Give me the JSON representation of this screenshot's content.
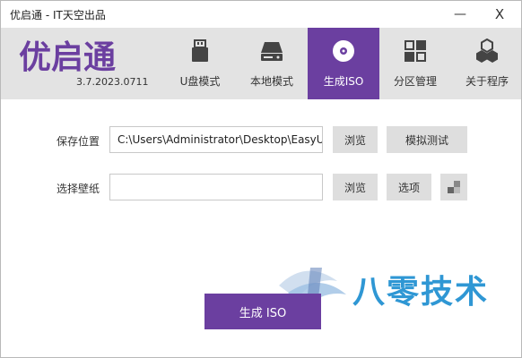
{
  "window": {
    "title": "优启通 - IT天空出品",
    "minimize_glyph": "—",
    "close_glyph": "X"
  },
  "header": {
    "version": "3.7.2023.0711",
    "logo_text": "优启通",
    "accent": "#6b3fa0",
    "nav": [
      {
        "label": "U盘模式",
        "icon": "usb-drive-icon"
      },
      {
        "label": "本地模式",
        "icon": "hard-drive-icon"
      },
      {
        "label": "生成ISO",
        "icon": "disc-icon",
        "active": true
      },
      {
        "label": "分区管理",
        "icon": "grid-icon"
      },
      {
        "label": "关于程序",
        "icon": "hexagons-icon"
      }
    ]
  },
  "form": {
    "save_location": {
      "label": "保存位置",
      "value": "C:\\Users\\Administrator\\Desktop\\EasyU_",
      "browse": "浏览",
      "simulate": "模拟测试"
    },
    "wallpaper": {
      "label": "选择壁纸",
      "value": "",
      "browse": "浏览",
      "options": "选项"
    }
  },
  "actions": {
    "generate": "生成 ISO"
  },
  "watermark": {
    "text": "八零技术"
  }
}
